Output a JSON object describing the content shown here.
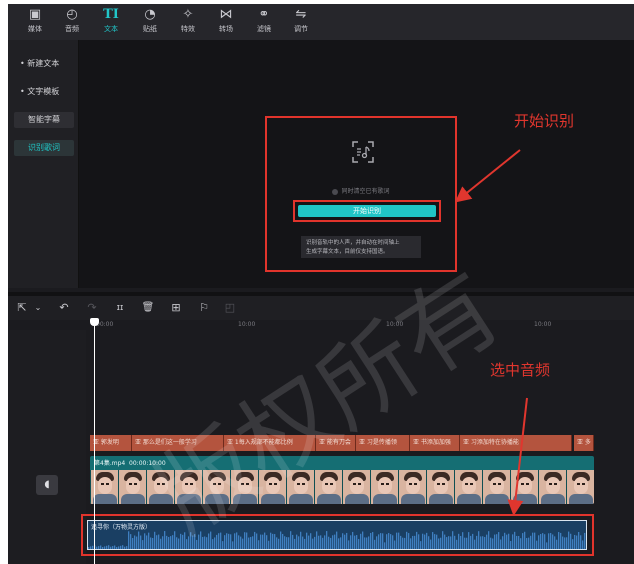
{
  "toolbar": {
    "items": [
      {
        "label": "媒体",
        "icon": "▣",
        "icon_name": "media-icon",
        "active": false
      },
      {
        "label": "音频",
        "icon": "◴",
        "icon_name": "audio-icon",
        "active": false
      },
      {
        "label": "文本",
        "icon": "TI",
        "icon_name": "text-icon",
        "active": true
      },
      {
        "label": "贴纸",
        "icon": "◔",
        "icon_name": "sticker-icon",
        "active": false
      },
      {
        "label": "特效",
        "icon": "✧",
        "icon_name": "effects-icon",
        "active": false
      },
      {
        "label": "转场",
        "icon": "⋈",
        "icon_name": "transition-icon",
        "active": false
      },
      {
        "label": "滤镜",
        "icon": "⚭",
        "icon_name": "filter-icon",
        "active": false
      },
      {
        "label": "调节",
        "icon": "⇋",
        "icon_name": "adjust-icon",
        "active": false
      }
    ],
    "accent_color": "#21c6c9"
  },
  "sidebar": {
    "items": [
      {
        "label": "• 新建文本"
      },
      {
        "label": "• 文字模板"
      },
      {
        "label": "智能字幕"
      },
      {
        "label": "识别歌词"
      }
    ]
  },
  "recognize_panel": {
    "icon_name": "lyric-recognize-icon",
    "option_text": "同时清空已有歌词",
    "start_button": "开始识别",
    "tip_line1": "识别音轨中的人声，并自动在时间轴上",
    "tip_line2": "生成字幕文本，目前仅支持国语。"
  },
  "annotations": {
    "start": "开始识别",
    "select": "选中音频",
    "color": "#e0362e"
  },
  "timeline_toolbar": {
    "tools": [
      {
        "icon": "⇱",
        "name": "select-tool-icon"
      },
      {
        "icon": "⌄",
        "name": "select-dropdown-icon"
      },
      {
        "icon": "↶",
        "name": "undo-icon"
      },
      {
        "icon": "↷",
        "name": "redo-icon"
      },
      {
        "icon": "ɪɪ",
        "name": "split-icon"
      },
      {
        "icon": "🗑",
        "name": "delete-icon"
      },
      {
        "icon": "⊞",
        "name": "freeze-icon"
      },
      {
        "icon": "⚐",
        "name": "marker-icon"
      },
      {
        "icon": "◰",
        "name": "crop-icon"
      }
    ]
  },
  "ruler": {
    "ticks": [
      "00:00",
      "10:00",
      "10:00",
      "10:00"
    ]
  },
  "subtitles": {
    "clips": [
      "亚 郭发明",
      "亚 那么是们这一般学习",
      "亚 1每入规部不能都比例",
      "亚 能有刀会",
      "亚 习是传播领",
      "亚 书添加加强",
      "亚 习添加特在协播能",
      "亚 多"
    ]
  },
  "video_clip": {
    "label": "第4集.mp4",
    "duration": "00:00:10:00"
  },
  "audio_clip": {
    "label": "追寻你（万物灵方版）"
  },
  "watermark": {
    "text": "版权所有"
  }
}
